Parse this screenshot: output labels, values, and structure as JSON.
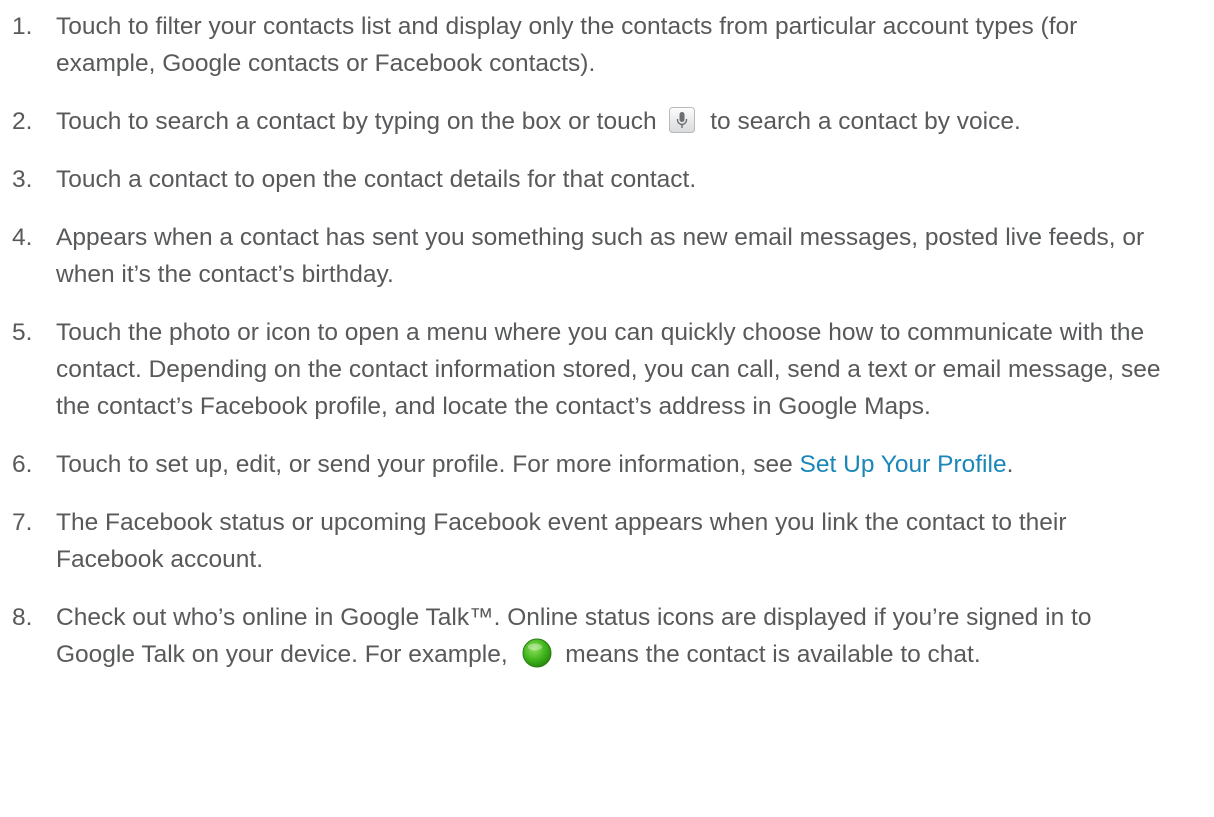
{
  "list": {
    "items": [
      {
        "number": "1.",
        "text": "Touch to filter your contacts list and display only the contacts from particular account types (for example, Google contacts or Facebook contacts)."
      },
      {
        "number": "2.",
        "text_before": "Touch to search a contact by typing on the box or touch",
        "icon": "microphone-icon",
        "text_after": "to search a contact by voice."
      },
      {
        "number": "3.",
        "text": "Touch a contact to open the contact details for that contact."
      },
      {
        "number": "4.",
        "text": "Appears when a contact has sent you something such as new email messages, posted live feeds, or when it’s the contact’s birthday."
      },
      {
        "number": "5.",
        "text": "Touch the photo or icon to open a menu where you can quickly choose how to communicate with the contact. Depending on the contact information stored, you can call, send a text or email message, see the contact’s Facebook profile, and locate the contact’s address in Google Maps."
      },
      {
        "number": "6.",
        "text_before": "Touch to set up, edit, or send your profile. For more information, see",
        "link": "Set Up Your Profile",
        "text_after": "."
      },
      {
        "number": "7.",
        "text": "The Facebook status or upcoming Facebook event appears when you link the contact to their Facebook account."
      },
      {
        "number": "8.",
        "text_before": "Check out who’s online in Google Talk™. Online status icons are displayed if you’re signed in to Google Talk on your device. For example,",
        "icon": "green-status-dot-icon",
        "text_after": "means the contact is available to chat."
      }
    ]
  },
  "colors": {
    "text": "#58595b",
    "link": "#1a87b8",
    "status_green": "#3cb31a"
  }
}
